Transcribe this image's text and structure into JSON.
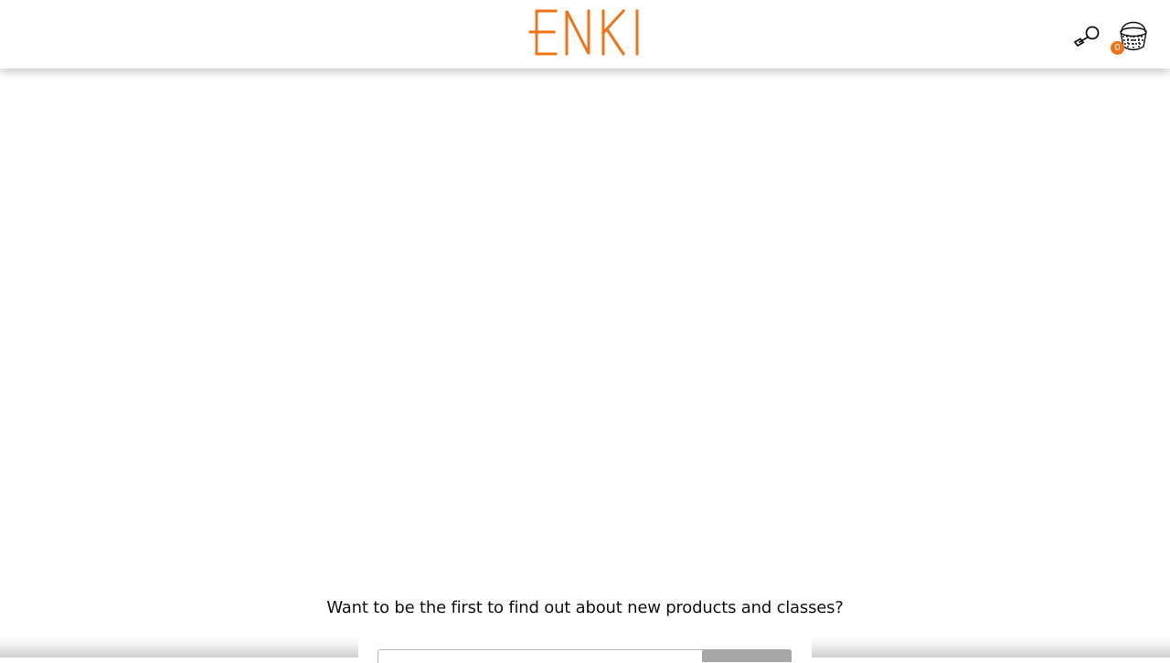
{
  "header": {
    "logo_text": "ENKI",
    "logo_color": "#f07318",
    "search_icon": "search-icon",
    "cart_icon": "basket-icon",
    "cart_count": "0"
  },
  "newsletter": {
    "heading": "Want to be the first to find out about new products and classes?",
    "email_value": "",
    "subscribe_label": ""
  }
}
